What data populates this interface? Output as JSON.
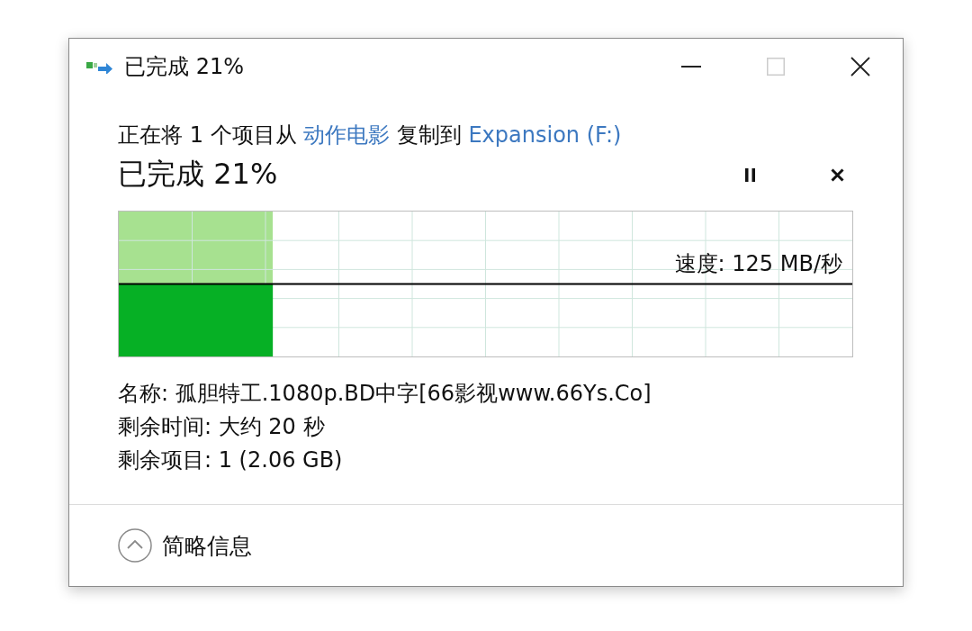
{
  "window": {
    "title": "已完成 21%",
    "controls": [
      {
        "kind": "minimize",
        "disabled": false
      },
      {
        "kind": "maximize",
        "disabled": true
      },
      {
        "kind": "close",
        "disabled": false
      }
    ]
  },
  "description": [
    {
      "kind": "text",
      "text": "正在将 1 个项目从"
    },
    {
      "kind": "link",
      "text": "动作电影"
    },
    {
      "kind": "text",
      "text": "复制到"
    },
    {
      "kind": "link",
      "text": "Expansion (F:)"
    }
  ],
  "heading": "已完成 21%",
  "progress": {
    "level": 0.21,
    "speed": "速度: 125 MB/秒"
  },
  "details": [
    "名称: 孤胆特工.1080p.BD中字[66影视www.66Ys.Co]",
    "剩余时间: 大约 20 秒",
    "剩余项目: 1 (2.06 GB)"
  ],
  "footer": {
    "toggle": "简略信息",
    "expanded": true
  }
}
